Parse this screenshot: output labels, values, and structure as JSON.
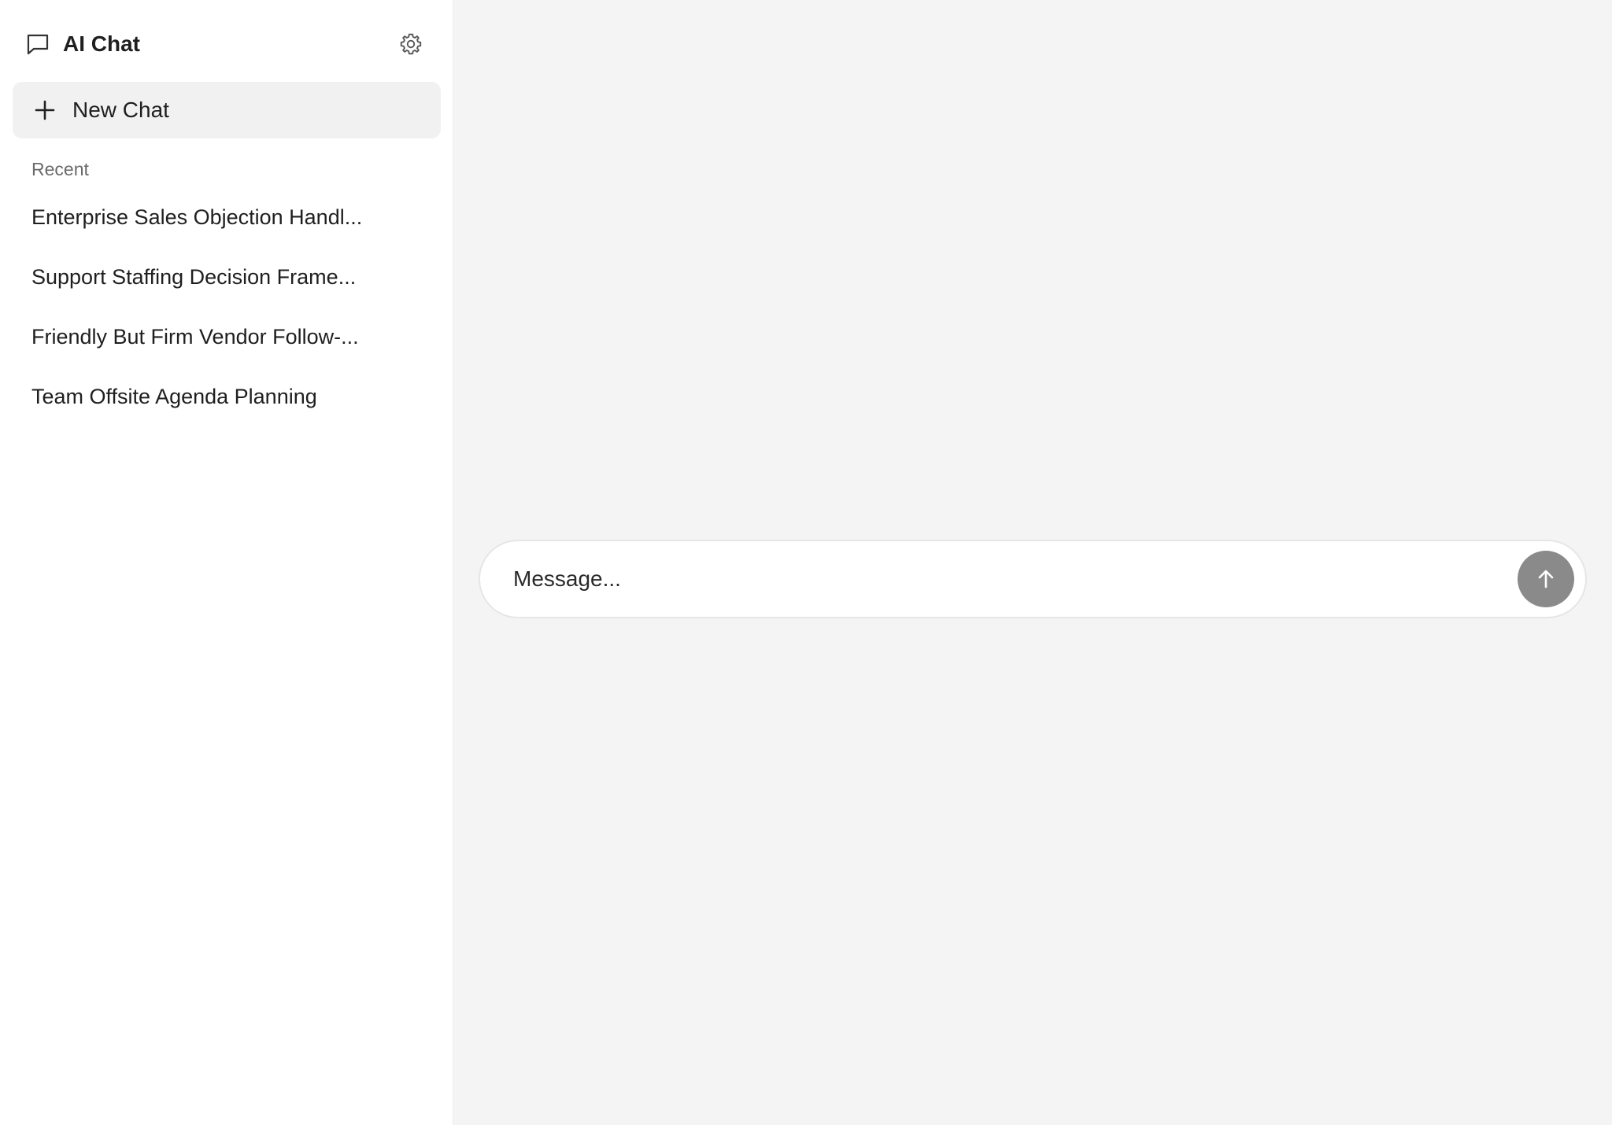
{
  "app": {
    "title": "AI Chat",
    "icon": "chat-bubble-icon",
    "settings_icon": "gear-icon"
  },
  "sidebar": {
    "new_chat_label": "New Chat",
    "new_chat_icon": "plus-icon",
    "section_label": "Recent",
    "recent": [
      {
        "label": "Enterprise Sales Objection Handl..."
      },
      {
        "label": "Support Staffing Decision Frame..."
      },
      {
        "label": "Friendly But Firm Vendor Follow-..."
      },
      {
        "label": "Team Offsite Agenda Planning"
      }
    ]
  },
  "composer": {
    "placeholder": "Message...",
    "value": "",
    "send_icon": "arrow-up-icon"
  },
  "colors": {
    "sidebar_bg": "#ffffff",
    "main_bg": "#f4f4f4",
    "new_chat_bg": "#f1f1f1",
    "send_button": "#8a8a8a",
    "text": "#1f1f1f",
    "muted_text": "#6a6a6a"
  }
}
